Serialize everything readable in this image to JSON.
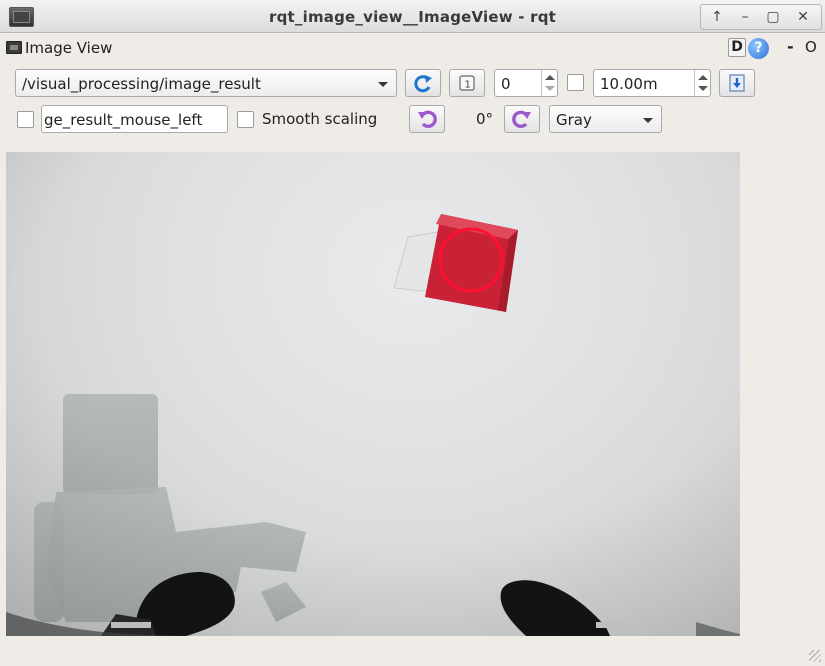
{
  "window": {
    "title": "rqt_image_view__ImageView - rqt",
    "controls": [
      "↑",
      "–",
      "▢",
      "✕"
    ]
  },
  "plugin": {
    "title": "Image View",
    "d_label": "D",
    "help_label": "?",
    "minimize_label": "-",
    "close_label": "O"
  },
  "toolbar": {
    "topic": "/visual_processing/image_result",
    "number_value": "0",
    "duration_value": "10.00m",
    "mouse_topic": "ge_result_mouse_left",
    "smooth_scaling_label": "Smooth scaling",
    "smooth_scaling_checked": false,
    "rotation_label": "0°",
    "color_scheme": "Gray"
  },
  "image": {
    "description_colors": {
      "cube": "#d42b3c",
      "circle": "#ff1030"
    }
  }
}
